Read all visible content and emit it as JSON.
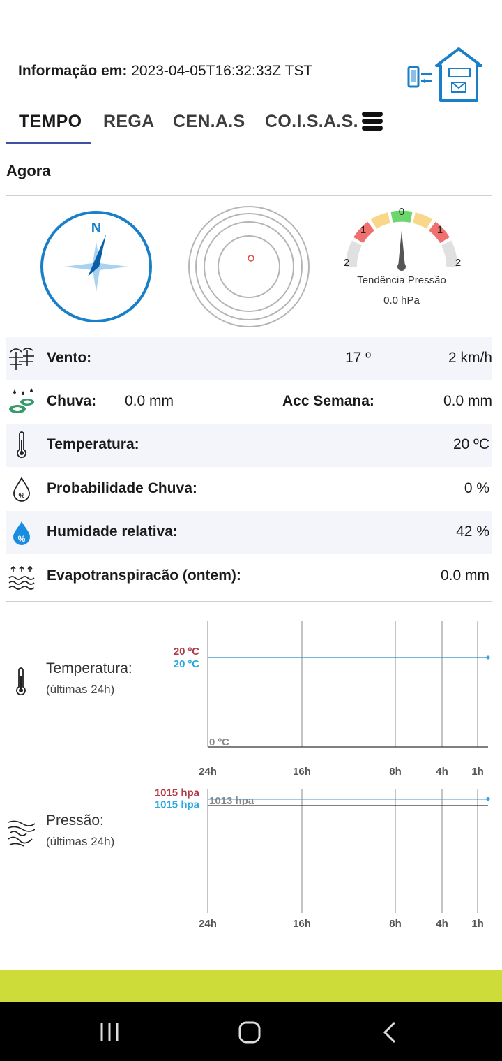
{
  "header": {
    "info_label": "Informação em:",
    "info_value": "2023-04-05T16:32:33Z TST"
  },
  "tabs": [
    {
      "label": "TEMPO",
      "active": true
    },
    {
      "label": "REGA",
      "active": false
    },
    {
      "label": "CEN.A.S",
      "active": false
    },
    {
      "label": "CO.I.S.A.S.",
      "active": false
    }
  ],
  "now": {
    "title": "Agora",
    "compass_letter": "N",
    "pressure_trend": {
      "ticks": [
        "0",
        "1",
        "1",
        "2",
        "2"
      ],
      "title": "Tendência Pressão",
      "value": "0.0 hPa"
    },
    "rows": {
      "wind": {
        "label": "Vento:",
        "direction": "17 º",
        "speed": "2 km/h"
      },
      "rain": {
        "label": "Chuva:",
        "value": "0.0 mm",
        "acc_label": "Acc Semana:",
        "acc_value": "0.0 mm"
      },
      "temperature": {
        "label": "Temperatura:",
        "value": "20 ºC"
      },
      "rain_prob": {
        "label": "Probabilidade Chuva:",
        "value": "0 %"
      },
      "humidity": {
        "label": "Humidade relativa:",
        "value": "42 %"
      },
      "evapo": {
        "label": "Evapotranspiracão (ontem):",
        "value": "0.0 mm"
      }
    }
  },
  "history": {
    "temperature": {
      "title": "Temperatura:",
      "subtitle": "(últimas 24h)"
    },
    "pressure": {
      "title": "Pressão:",
      "subtitle": "(últimas 24h)"
    }
  },
  "chart_data": [
    {
      "type": "line",
      "x_ticks": [
        "24h",
        "16h",
        "8h",
        "4h",
        "1h"
      ],
      "series": [
        {
          "label": "20 ºC",
          "value": 20,
          "color": "#b03a48"
        },
        {
          "label": "20 ºC",
          "value": 20,
          "color": "#29a9e0"
        }
      ],
      "reference": {
        "label": "0 ºC",
        "value": 0
      },
      "ylim": [
        0,
        25
      ]
    },
    {
      "type": "line",
      "x_ticks": [
        "24h",
        "16h",
        "8h",
        "4h",
        "1h"
      ],
      "series": [
        {
          "label": "1015 hpa",
          "value": 1015,
          "color": "#b03a48"
        },
        {
          "label": "1015 hpa",
          "value": 1015,
          "color": "#29a9e0"
        }
      ],
      "reference": {
        "label": "1013 hpa",
        "value": 1013
      },
      "ylim": [
        980,
        1016
      ]
    }
  ],
  "colors": {
    "accent": "#3f51a3",
    "bottom_bar": "#cddc39",
    "compass_blue": "#1a7fc9"
  }
}
